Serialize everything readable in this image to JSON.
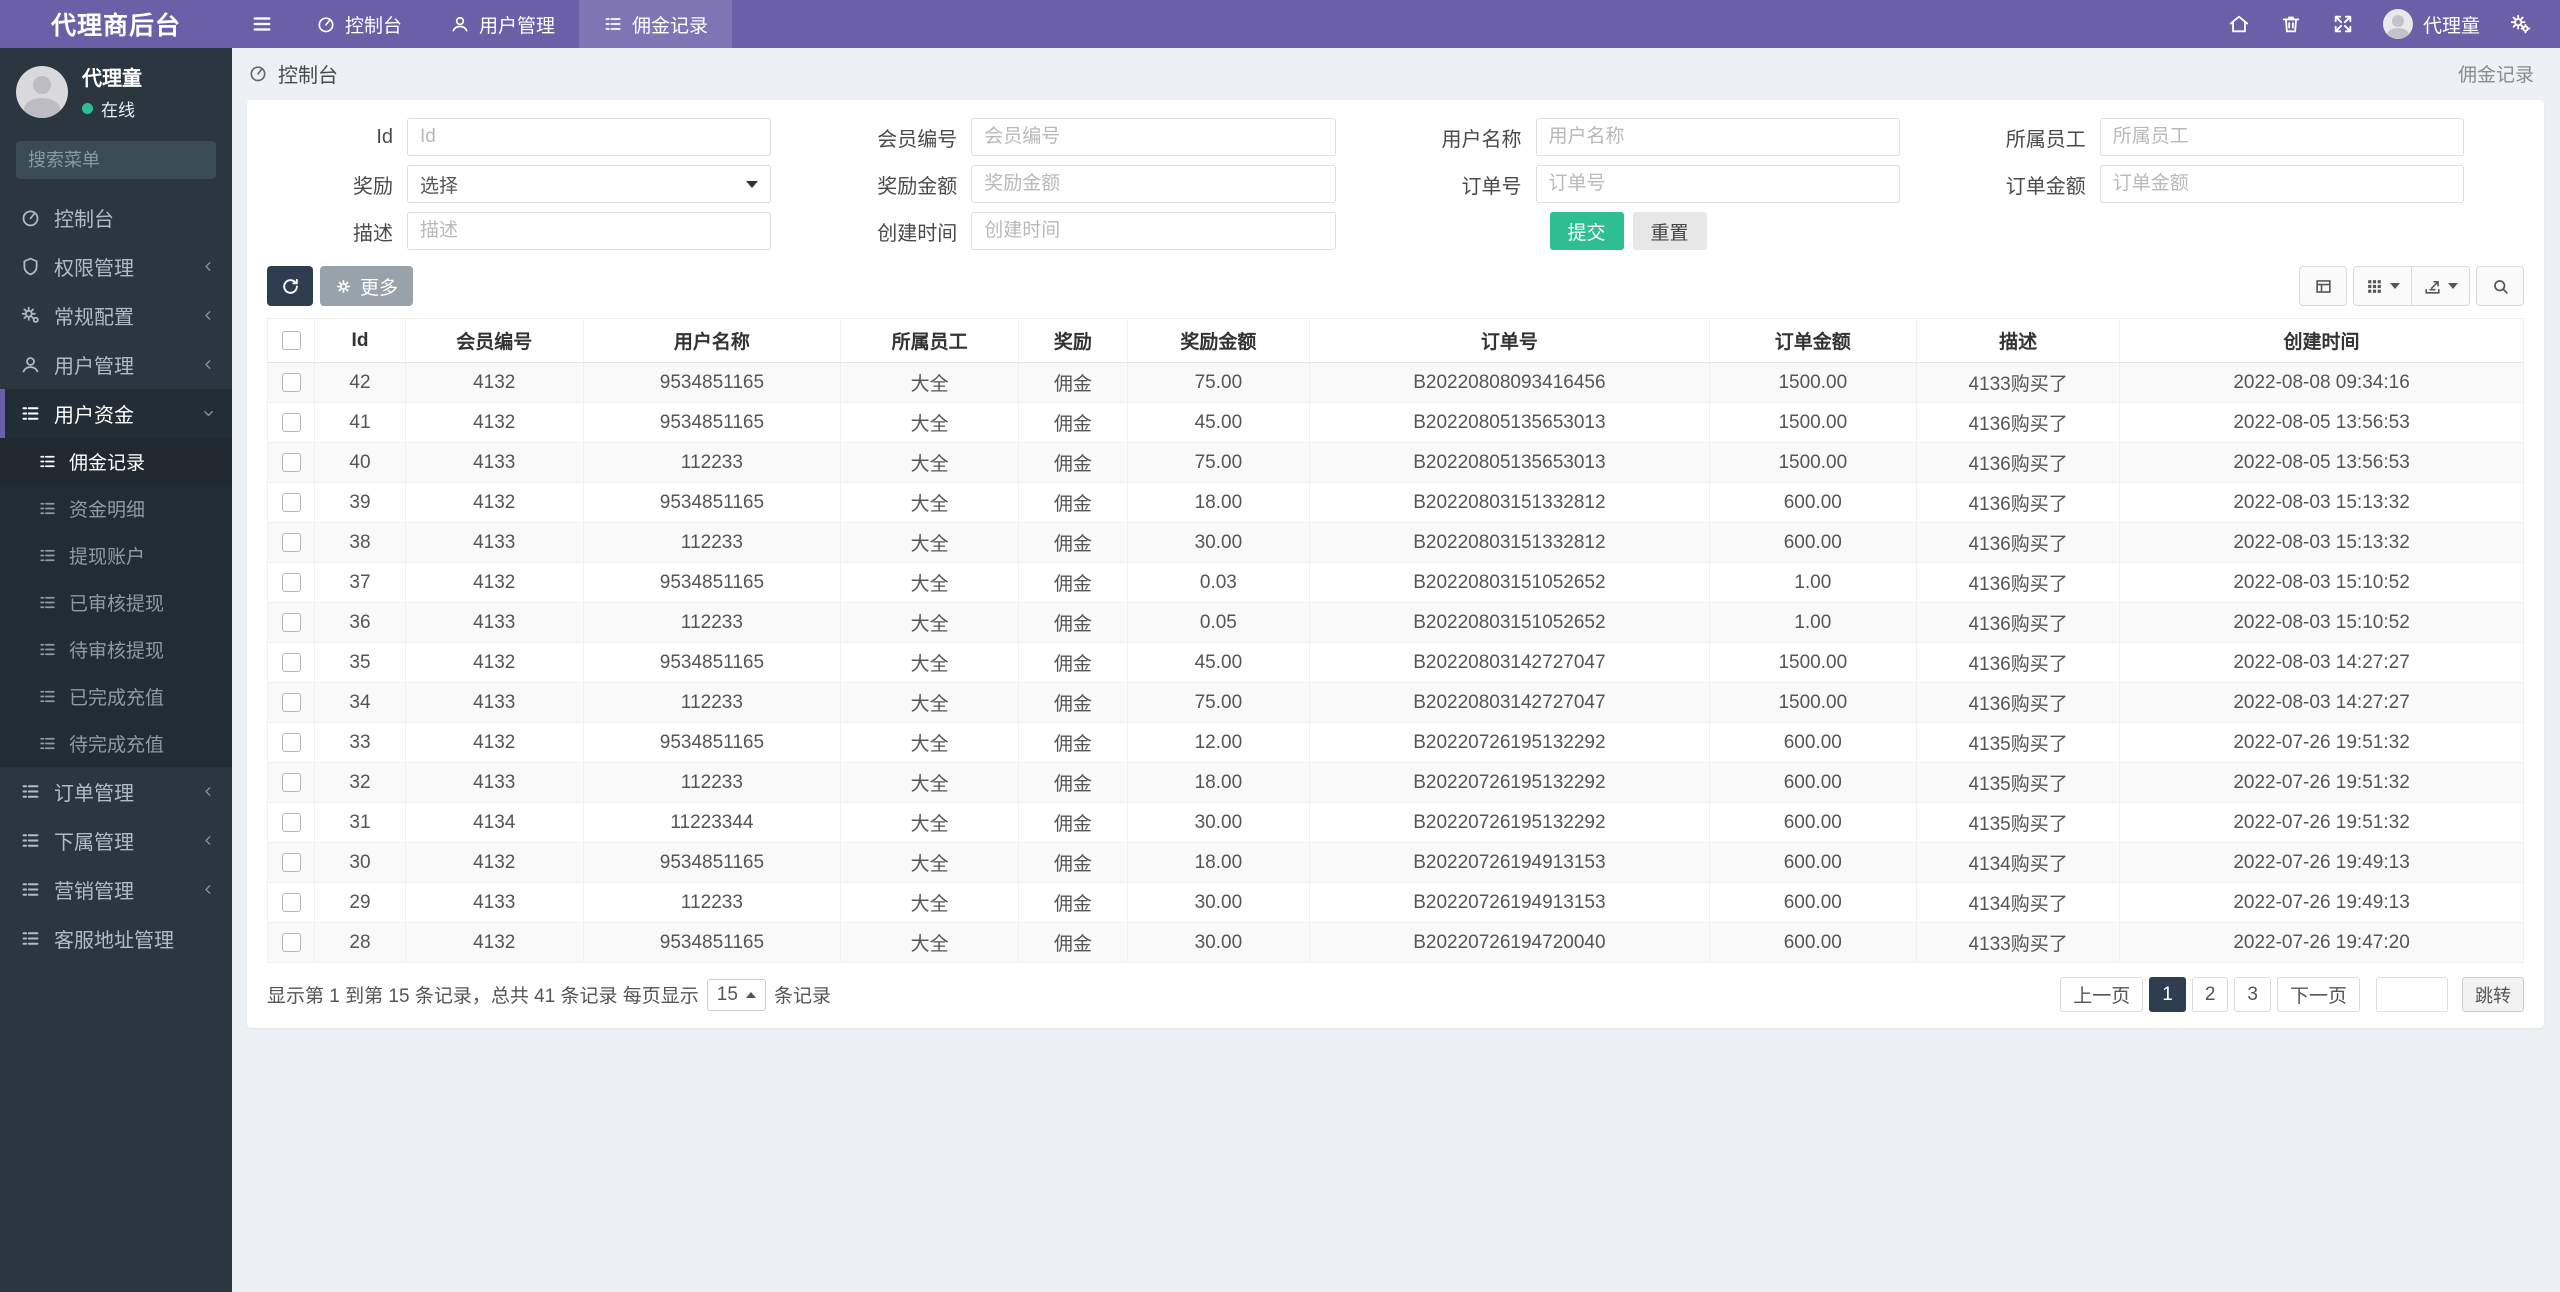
{
  "navbar": {
    "brand": "代理商后台",
    "tabs": [
      {
        "key": "dashboard",
        "label": "控制台",
        "active": false
      },
      {
        "key": "users",
        "label": "用户管理",
        "active": false
      },
      {
        "key": "commission",
        "label": "佣金记录",
        "active": true
      }
    ],
    "user_name": "代理童"
  },
  "sidebar": {
    "user_name": "代理童",
    "user_status": "在线",
    "search_placeholder": "搜索菜单",
    "menu": [
      {
        "key": "dashboard",
        "icon": "gauge",
        "label": "控制台"
      },
      {
        "key": "permissions",
        "icon": "shield",
        "label": "权限管理",
        "chevron": true
      },
      {
        "key": "general-config",
        "icon": "gears",
        "label": "常规配置",
        "chevron": true
      },
      {
        "key": "user-management",
        "icon": "user",
        "label": "用户管理",
        "chevron": true
      },
      {
        "key": "user-funds",
        "icon": "list",
        "label": "用户资金",
        "active": true,
        "expanded": true,
        "children": [
          {
            "key": "commission-records",
            "label": "佣金记录",
            "active": true
          },
          {
            "key": "fund-details",
            "label": "资金明细"
          },
          {
            "key": "withdraw-accounts",
            "label": "提现账户"
          },
          {
            "key": "approved-withdrawals",
            "label": "已审核提现"
          },
          {
            "key": "pending-withdrawals",
            "label": "待审核提现"
          },
          {
            "key": "completed-recharges",
            "label": "已完成充值"
          },
          {
            "key": "pending-recharges",
            "label": "待完成充值"
          }
        ]
      },
      {
        "key": "order-management",
        "icon": "list",
        "label": "订单管理",
        "chevron": true
      },
      {
        "key": "subordinate-management",
        "icon": "list",
        "label": "下属管理",
        "chevron": true
      },
      {
        "key": "marketing-management",
        "icon": "list",
        "label": "营销管理",
        "chevron": true
      },
      {
        "key": "service-address",
        "icon": "list",
        "label": "客服地址管理"
      }
    ]
  },
  "breadcrumb": {
    "title": "控制台",
    "right": "佣金记录"
  },
  "filters": {
    "fields": [
      {
        "key": "id",
        "label": "Id",
        "placeholder": "Id",
        "type": "input"
      },
      {
        "key": "member-no",
        "label": "会员编号",
        "placeholder": "会员编号",
        "type": "input"
      },
      {
        "key": "user-name",
        "label": "用户名称",
        "placeholder": "用户名称",
        "type": "input"
      },
      {
        "key": "staff",
        "label": "所属员工",
        "placeholder": "所属员工",
        "type": "input"
      },
      {
        "key": "reward",
        "label": "奖励",
        "value": "选择",
        "type": "select"
      },
      {
        "key": "reward-amount",
        "label": "奖励金额",
        "placeholder": "奖励金额",
        "type": "input"
      },
      {
        "key": "order-no",
        "label": "订单号",
        "placeholder": "订单号",
        "type": "input"
      },
      {
        "key": "order-amount",
        "label": "订单金额",
        "placeholder": "订单金额",
        "type": "input"
      },
      {
        "key": "description",
        "label": "描述",
        "placeholder": "描述",
        "type": "input"
      },
      {
        "key": "created-at",
        "label": "创建时间",
        "placeholder": "创建时间",
        "type": "input"
      }
    ],
    "submit_label": "提交",
    "reset_label": "重置"
  },
  "toolbar": {
    "more_label": "更多"
  },
  "table": {
    "columns": [
      "Id",
      "会员编号",
      "用户名称",
      "所属员工",
      "奖励",
      "奖励金额",
      "订单号",
      "订单金额",
      "描述",
      "创建时间"
    ],
    "rows": [
      [
        "42",
        "4132",
        "9534851165",
        "大全",
        "佣金",
        "75.00",
        "B20220808093416456",
        "1500.00",
        "4133购买了",
        "2022-08-08 09:34:16"
      ],
      [
        "41",
        "4132",
        "9534851165",
        "大全",
        "佣金",
        "45.00",
        "B20220805135653013",
        "1500.00",
        "4136购买了",
        "2022-08-05 13:56:53"
      ],
      [
        "40",
        "4133",
        "112233",
        "大全",
        "佣金",
        "75.00",
        "B20220805135653013",
        "1500.00",
        "4136购买了",
        "2022-08-05 13:56:53"
      ],
      [
        "39",
        "4132",
        "9534851165",
        "大全",
        "佣金",
        "18.00",
        "B20220803151332812",
        "600.00",
        "4136购买了",
        "2022-08-03 15:13:32"
      ],
      [
        "38",
        "4133",
        "112233",
        "大全",
        "佣金",
        "30.00",
        "B20220803151332812",
        "600.00",
        "4136购买了",
        "2022-08-03 15:13:32"
      ],
      [
        "37",
        "4132",
        "9534851165",
        "大全",
        "佣金",
        "0.03",
        "B20220803151052652",
        "1.00",
        "4136购买了",
        "2022-08-03 15:10:52"
      ],
      [
        "36",
        "4133",
        "112233",
        "大全",
        "佣金",
        "0.05",
        "B20220803151052652",
        "1.00",
        "4136购买了",
        "2022-08-03 15:10:52"
      ],
      [
        "35",
        "4132",
        "9534851165",
        "大全",
        "佣金",
        "45.00",
        "B20220803142727047",
        "1500.00",
        "4136购买了",
        "2022-08-03 14:27:27"
      ],
      [
        "34",
        "4133",
        "112233",
        "大全",
        "佣金",
        "75.00",
        "B20220803142727047",
        "1500.00",
        "4136购买了",
        "2022-08-03 14:27:27"
      ],
      [
        "33",
        "4132",
        "9534851165",
        "大全",
        "佣金",
        "12.00",
        "B20220726195132292",
        "600.00",
        "4135购买了",
        "2022-07-26 19:51:32"
      ],
      [
        "32",
        "4133",
        "112233",
        "大全",
        "佣金",
        "18.00",
        "B20220726195132292",
        "600.00",
        "4135购买了",
        "2022-07-26 19:51:32"
      ],
      [
        "31",
        "4134",
        "11223344",
        "大全",
        "佣金",
        "30.00",
        "B20220726195132292",
        "600.00",
        "4135购买了",
        "2022-07-26 19:51:32"
      ],
      [
        "30",
        "4132",
        "9534851165",
        "大全",
        "佣金",
        "18.00",
        "B20220726194913153",
        "600.00",
        "4134购买了",
        "2022-07-26 19:49:13"
      ],
      [
        "29",
        "4133",
        "112233",
        "大全",
        "佣金",
        "30.00",
        "B20220726194913153",
        "600.00",
        "4134购买了",
        "2022-07-26 19:49:13"
      ],
      [
        "28",
        "4132",
        "9534851165",
        "大全",
        "佣金",
        "30.00",
        "B20220726194720040",
        "600.00",
        "4133购买了",
        "2022-07-26 19:47:20"
      ]
    ]
  },
  "pagination": {
    "summary_prefix": "显示第 1 到第 15 条记录，总共 41 条记录 每页显示",
    "page_size": "15",
    "summary_suffix": "条记录",
    "prev_label": "上一页",
    "pages": [
      "1",
      "2",
      "3"
    ],
    "active_page": "1",
    "next_label": "下一页",
    "jump_label": "跳转"
  },
  "colors": {
    "accent_purple": "#6b5fa8",
    "submit_green": "#2fbe91",
    "navy": "#2e3d50",
    "sidebar_dark": "#2b3640",
    "online_green": "#2fbe91"
  }
}
